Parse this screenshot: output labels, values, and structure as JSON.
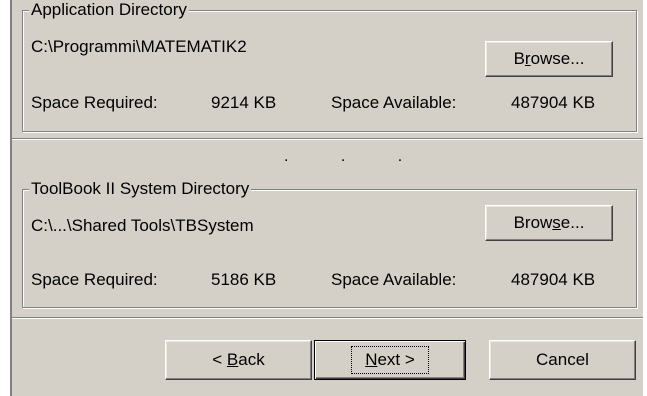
{
  "app_group": {
    "title": "Application Directory",
    "path": "C:\\Programmi\\MATEMATIK2",
    "browse": {
      "before": "B",
      "mnemonic": "r",
      "after": "owse..."
    },
    "space_required_label": "Space Required:",
    "space_required_value": "9214 KB",
    "space_available_label": "Space Available:",
    "space_available_value": "487904 KB"
  },
  "divider_dots": ". . .",
  "tb_group": {
    "title": "ToolBook II System Directory",
    "path": "C:\\...\\Shared Tools\\TBSystem",
    "browse": {
      "before": "Brow",
      "mnemonic": "s",
      "after": "e..."
    },
    "space_required_label": "Space Required:",
    "space_required_value": "5186 KB",
    "space_available_label": "Space Available:",
    "space_available_value": "487904 KB"
  },
  "buttons": {
    "back": {
      "before": "< ",
      "mnemonic": "B",
      "after": "ack"
    },
    "next": {
      "before": "",
      "mnemonic": "N",
      "after": "ext >"
    },
    "cancel": "Cancel"
  }
}
